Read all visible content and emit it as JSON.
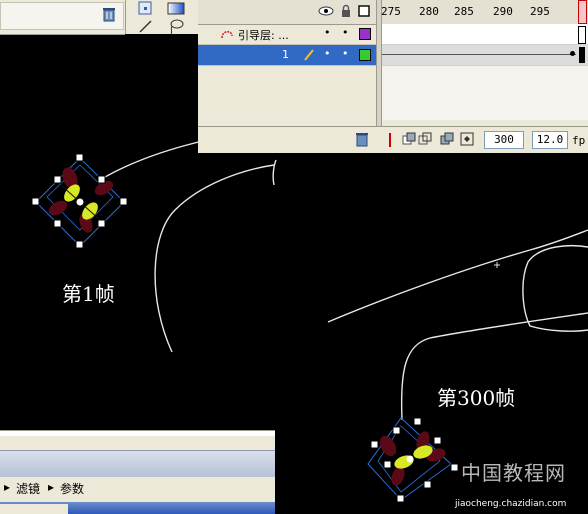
{
  "timeline": {
    "ruler": [
      "275",
      "280",
      "285",
      "290",
      "295"
    ],
    "layers": [
      {
        "name": "引导层: ...",
        "dots": [
          "•",
          "•"
        ],
        "color": "#9b30c8"
      },
      {
        "name": "1",
        "dots": [
          "•",
          "•"
        ],
        "color": "#33cc33"
      }
    ],
    "current_frame": "300",
    "fps": "12.0",
    "fps_unit": "fp"
  },
  "panel": {
    "tabs": [
      {
        "icon": "▸",
        "label": "滤镜"
      },
      {
        "icon": "▸",
        "label": "参数"
      }
    ]
  },
  "stage": {
    "caption_frame1": "第1帧",
    "caption_frame300": "第300帧"
  },
  "watermark": {
    "title": "中国教程网",
    "url": "jiaocheng.chazidian.com"
  },
  "colors": {
    "stage_bg": "#000000",
    "ui_bg": "#ece9d8",
    "path": "#e8e8e8",
    "selection_box": "#2a6fd6",
    "playhead": "#cc0000"
  }
}
